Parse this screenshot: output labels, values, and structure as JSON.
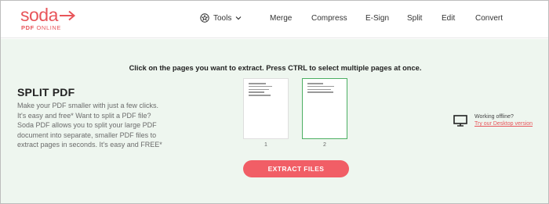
{
  "brand": {
    "name": "soda",
    "sub_pdf": "PDF",
    "sub_online": "ONLINE",
    "color": "#e8555a"
  },
  "nav": {
    "tools": "Tools",
    "items": [
      "Merge",
      "Compress",
      "E-Sign",
      "Split",
      "Edit",
      "Convert"
    ]
  },
  "main": {
    "instruction": "Click on the pages you want to extract. Press CTRL to select multiple pages at once.",
    "title": "SPLIT PDF",
    "description": "Make your PDF smaller with just a few clicks. It's easy and free* Want to split a PDF file? Soda PDF allows you to split your large PDF document into separate, smaller PDF files to extract pages in seconds. It's easy and FREE*",
    "pages": [
      {
        "number": "1",
        "selected": false
      },
      {
        "number": "2",
        "selected": true
      }
    ],
    "extract_button": "EXTRACT FILES",
    "offline_title": "Working offline?",
    "offline_link": "Try our Desktop version"
  },
  "colors": {
    "background": "#eef6ef",
    "accent": "#f15e66",
    "selected_border": "#4caf62"
  }
}
